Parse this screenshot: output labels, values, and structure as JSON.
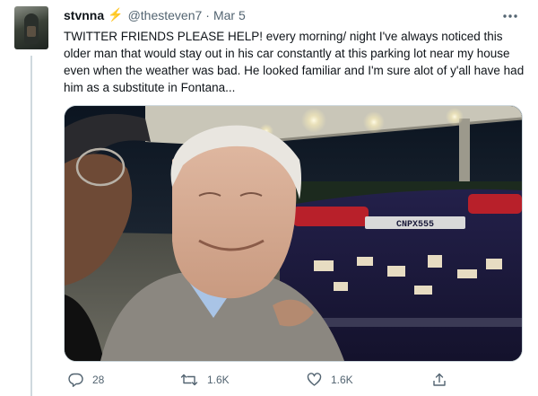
{
  "tweet": {
    "display_name": "stvnna",
    "name_emoji": "⚡",
    "handle": "@thesteven7",
    "separator": "·",
    "date": "Mar 5",
    "text": "TWITTER FRIENDS PLEASE HELP! every morning/ night I've always noticed this older man that would stay out in his car constantly at this parking lot near my house even when the weather was bad. He looked familiar and I'm sure alot of y'all have had him as a substitute in Fontana...",
    "media": {
      "license_plate": "CNPX555"
    }
  },
  "actions": {
    "replies": "28",
    "retweets": "1.6K",
    "likes": "1.6K"
  },
  "icons": {
    "reply": "reply-icon",
    "retweet": "retweet-icon",
    "like": "heart-icon",
    "share": "share-icon",
    "more": "more-icon"
  },
  "colors": {
    "muted": "#536471",
    "text": "#0f1419",
    "bolt": "#f4b400",
    "border": "#cfd9de"
  }
}
